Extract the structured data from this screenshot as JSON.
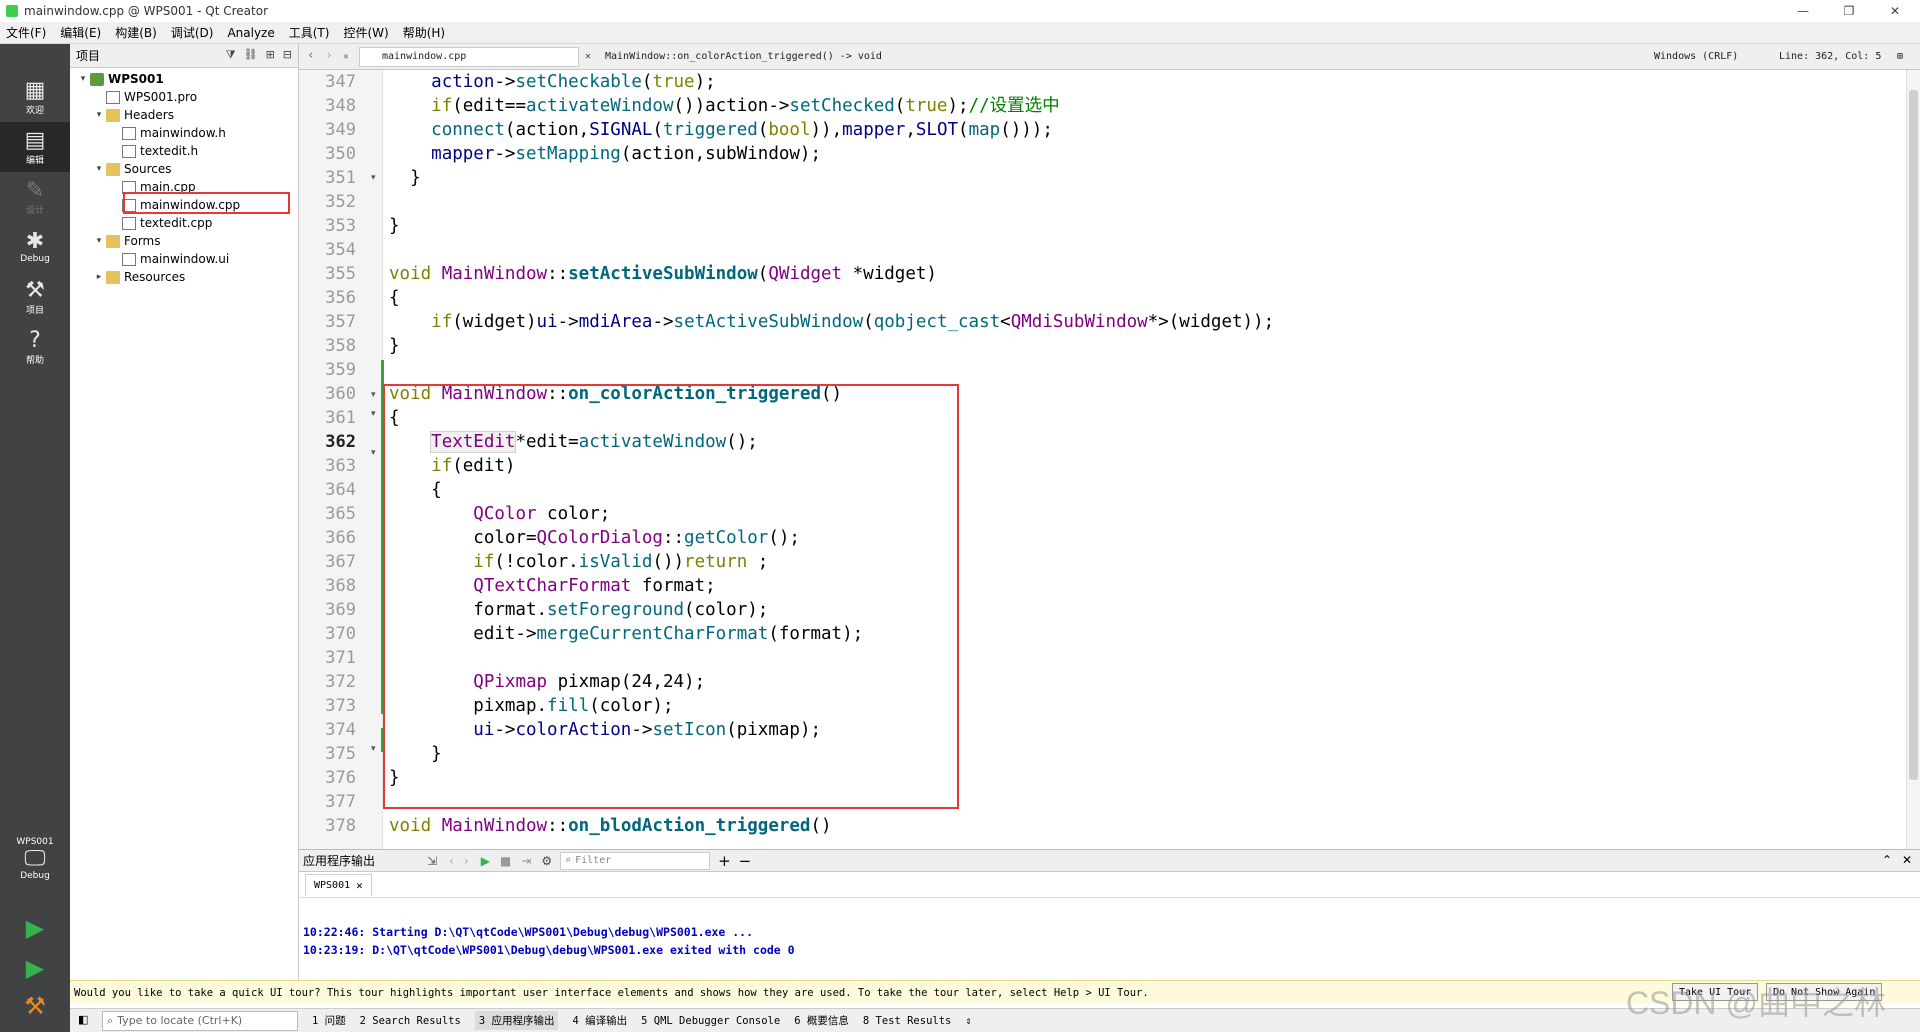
{
  "window": {
    "title": "mainwindow.cpp @ WPS001 - Qt Creator",
    "min": "—",
    "max": "❐",
    "close": "✕"
  },
  "menu": [
    "文件(F)",
    "编辑(E)",
    "构建(B)",
    "调试(D)",
    "Analyze",
    "工具(T)",
    "控件(W)",
    "帮助(H)"
  ],
  "modes": [
    {
      "label": "欢迎",
      "icon": "grid-icon"
    },
    {
      "label": "编辑",
      "icon": "edit-icon"
    },
    {
      "label": "设计",
      "icon": "pen-icon"
    },
    {
      "label": "Debug",
      "icon": "bug-icon"
    },
    {
      "label": "项目",
      "icon": "wrench-icon"
    },
    {
      "label": "帮助",
      "icon": "help-icon"
    }
  ],
  "kit": {
    "project": "WPS001",
    "config": "Debug"
  },
  "project_panel": {
    "title": "项目",
    "tree": [
      {
        "label": "WPS001",
        "kind": "proj",
        "level": 0,
        "arrow": "▾"
      },
      {
        "label": "WPS001.pro",
        "kind": "file",
        "level": 1,
        "arrow": ""
      },
      {
        "label": "Headers",
        "kind": "folder",
        "level": 1,
        "arrow": "▾"
      },
      {
        "label": "mainwindow.h",
        "kind": "file",
        "level": 2,
        "arrow": ""
      },
      {
        "label": "textedit.h",
        "kind": "file",
        "level": 2,
        "arrow": ""
      },
      {
        "label": "Sources",
        "kind": "folder",
        "level": 1,
        "arrow": "▾"
      },
      {
        "label": "main.cpp",
        "kind": "file",
        "level": 2,
        "arrow": ""
      },
      {
        "label": "mainwindow.cpp",
        "kind": "file",
        "level": 2,
        "arrow": ""
      },
      {
        "label": "textedit.cpp",
        "kind": "file",
        "level": 2,
        "arrow": ""
      },
      {
        "label": "Forms",
        "kind": "folder",
        "level": 1,
        "arrow": "▾"
      },
      {
        "label": "mainwindow.ui",
        "kind": "file",
        "level": 2,
        "arrow": ""
      },
      {
        "label": "Resources",
        "kind": "folder",
        "level": 1,
        "arrow": "▸"
      }
    ]
  },
  "editor": {
    "file_tab": "mainwindow.cpp",
    "symbol": "MainWindow::on_colorAction_triggered() -> void",
    "line_ending": "Windows (CRLF)",
    "position": "Line: 362, Col: 5",
    "current_line": "362",
    "line_numbers": [
      "347",
      "348",
      "349",
      "350",
      "351",
      "352",
      "353",
      "354",
      "355",
      "356",
      "357",
      "358",
      "359",
      "360",
      "361",
      "362",
      "363",
      "364",
      "365",
      "366",
      "367",
      "368",
      "369",
      "370",
      "371",
      "372",
      "373",
      "374",
      "375",
      "376",
      "377",
      "378"
    ]
  },
  "output": {
    "title": "应用程序输出",
    "filter_placeholder": "Filter",
    "tab": "WPS001",
    "lines": [
      "10:22:46: Starting D:\\QT\\qtCode\\WPS001\\Debug\\debug\\WPS001.exe ...",
      "10:23:19: D:\\QT\\qtCode\\WPS001\\Debug\\debug\\WPS001.exe exited with code 0"
    ]
  },
  "tour": {
    "message": "Would you like to take a quick UI tour? This tour highlights important user interface elements and shows how they are used. To take the tour later, select Help > UI Tour.",
    "take": "Take UI Tour",
    "dont": "Do Not Show Again"
  },
  "status": {
    "locate_placeholder": "Type to locate (Ctrl+K)",
    "panes": [
      "1 问题",
      "2 Search Results",
      "3 应用程序输出",
      "4 编译输出",
      "5 QML Debugger Console",
      "6 概要信息",
      "8 Test Results"
    ]
  },
  "watermark": "CSDN @曲中之林"
}
